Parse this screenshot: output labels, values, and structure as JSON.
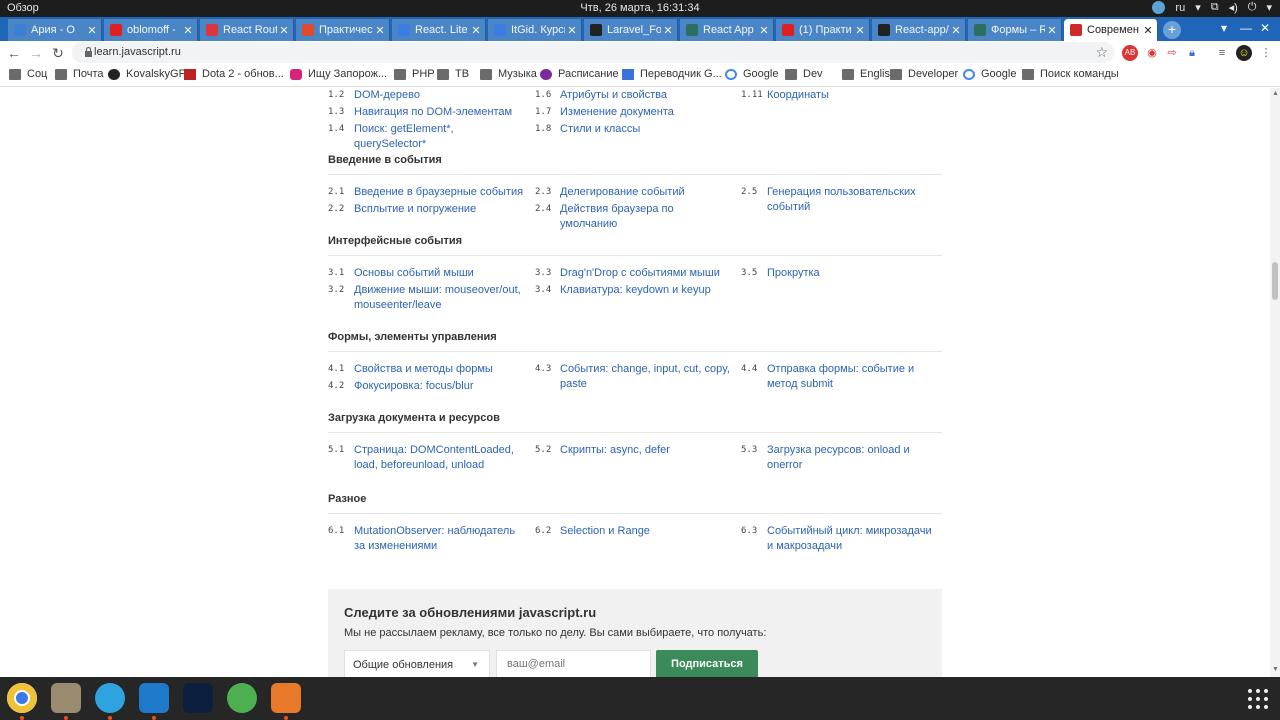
{
  "system_bar": {
    "activities": "Обзор",
    "clock": "Чтв, 26 марта, 16:31:34",
    "lang": "ru"
  },
  "tabs": [
    {
      "title": "Ария - О",
      "fav_color": "#3f7fd3"
    },
    {
      "title": "oblomoff - ",
      "fav_color": "#e02020"
    },
    {
      "title": "React Route",
      "fav_color": "#d9363e"
    },
    {
      "title": "Практическ",
      "fav_color": "#e04a2f"
    },
    {
      "title": "React. Lite",
      "fav_color": "#3d7ce0"
    },
    {
      "title": "ItGid. Курсы",
      "fav_color": "#3d7ce0"
    },
    {
      "title": "Laravel_For",
      "fav_color": "#222222"
    },
    {
      "title": "React App",
      "fav_color": "#2d6e5e"
    },
    {
      "title": "(1) Практи",
      "fav_color": "#e02020"
    },
    {
      "title": "React-app/",
      "fav_color": "#222222"
    },
    {
      "title": "Формы – R",
      "fav_color": "#2d6e5e"
    },
    {
      "title": "Современ",
      "fav_color": "#cc2a2a"
    }
  ],
  "toolbar": {
    "url": "learn.javascript.ru"
  },
  "bookmarks": [
    {
      "label": "Соц",
      "icon": "folder-icon"
    },
    {
      "label": "Почта",
      "icon": "folder-icon"
    },
    {
      "label": "KovalskyGF",
      "icon": "github-icon"
    },
    {
      "label": "Dota 2 - обнов...",
      "icon": "dota-icon"
    },
    {
      "label": "Ищу Запорож...",
      "icon": "instagram-icon"
    },
    {
      "label": "PHP",
      "icon": "folder-icon"
    },
    {
      "label": "ТВ",
      "icon": "folder-icon"
    },
    {
      "label": "Музыка",
      "icon": "folder-icon"
    },
    {
      "label": "Расписание",
      "icon": "schedule-icon"
    },
    {
      "label": "Переводчик G...",
      "icon": "translate-icon"
    },
    {
      "label": "Google",
      "icon": "google-icon"
    },
    {
      "label": "Dev",
      "icon": "folder-icon"
    },
    {
      "label": "English",
      "icon": "folder-icon"
    },
    {
      "label": "Developer",
      "icon": "folder-icon"
    },
    {
      "label": "Google",
      "icon": "google-icon"
    },
    {
      "label": "Поиск команды",
      "icon": "folder-icon"
    }
  ],
  "top_rows": [
    {
      "num": "1.2",
      "text": "DOM-дерево"
    },
    {
      "num": "1.6",
      "text": "Атрибуты и свойства"
    },
    {
      "num": "1.11",
      "text": "Координаты"
    },
    {
      "num": "1.3",
      "text": "Навигация по DOM-элементам"
    },
    {
      "num": "1.7",
      "text": "Изменение документа"
    },
    {
      "num": "1.4",
      "text": "Поиск: getElement*, querySelector*"
    },
    {
      "num": "1.8",
      "text": "Стили и классы"
    }
  ],
  "sections": [
    {
      "title": "Введение в события",
      "items": [
        {
          "num": "2.1",
          "text": "Введение в браузерные события"
        },
        {
          "num": "2.2",
          "text": "Всплытие и погружение"
        },
        {
          "num": "2.3",
          "text": "Делегирование событий"
        },
        {
          "num": "2.4",
          "text": "Действия браузера по умолчанию"
        },
        {
          "num": "2.5",
          "text": "Генерация пользовательских событий"
        }
      ]
    },
    {
      "title": "Интерфейсные события",
      "items": [
        {
          "num": "3.1",
          "text": "Основы событий мыши"
        },
        {
          "num": "3.2",
          "text": "Движение мыши: mouseover/out, mouseenter/leave"
        },
        {
          "num": "3.3",
          "text": "Drag'n'Drop с событиями мыши"
        },
        {
          "num": "3.4",
          "text": "Клавиатура: keydown и keyup"
        },
        {
          "num": "3.5",
          "text": "Прокрутка"
        }
      ]
    },
    {
      "title": "Формы, элементы управления",
      "items": [
        {
          "num": "4.1",
          "text": "Свойства и методы формы"
        },
        {
          "num": "4.2",
          "text": "Фокусировка: focus/blur"
        },
        {
          "num": "4.3",
          "text": "События: change, input, cut, copy, paste"
        },
        {
          "num": "4.4",
          "text": "Отправка формы: событие и метод submit"
        }
      ]
    },
    {
      "title": "Загрузка документа и ресурсов",
      "items": [
        {
          "num": "5.1",
          "text": "Страница: DOMContentLoaded, load, beforeunload, unload"
        },
        {
          "num": "5.2",
          "text": "Скрипты: async, defer"
        },
        {
          "num": "5.3",
          "text": "Загрузка ресурсов: onload и onerror"
        }
      ]
    },
    {
      "title": "Разное",
      "items": [
        {
          "num": "6.1",
          "text": "MutationObserver: наблюдатель за изменениями"
        },
        {
          "num": "6.2",
          "text": "Selection и Range"
        },
        {
          "num": "6.3",
          "text": "Событийный цикл: микрозадачи и макрозадачи"
        }
      ]
    }
  ],
  "subscribe": {
    "title": "Следите за обновлениями javascript.ru",
    "text": "Мы не рассылаем рекламу, все только по делу. Вы сами выбираете, что получать:",
    "select_value": "Общие обновления",
    "email_placeholder": "ваш@email",
    "button": "Подписаться"
  },
  "dock": [
    {
      "name": "chrome-icon",
      "color": "#d93b2b"
    },
    {
      "name": "files-icon",
      "color": "#9a8a70"
    },
    {
      "name": "telegram-icon",
      "color": "#2ea3dd"
    },
    {
      "name": "vscode-icon",
      "color": "#1e7acb"
    },
    {
      "name": "photoshop-icon",
      "color": "#0d1f3f"
    },
    {
      "name": "pinwheel-icon",
      "color": "#4caf50"
    },
    {
      "name": "software-store-icon",
      "color": "#e8792b"
    }
  ],
  "colors": {
    "link": "#2c64b2",
    "tabstrip": "#1f66b8",
    "subscribe_button": "#3a8a5a"
  }
}
